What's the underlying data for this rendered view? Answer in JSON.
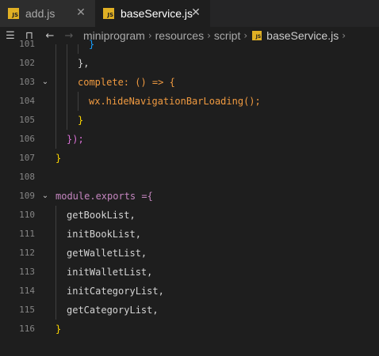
{
  "tabs": [
    {
      "label": "add.js",
      "badge": "JS",
      "active": false
    },
    {
      "label": "baseService.js",
      "badge": "JS",
      "active": true
    }
  ],
  "breadcrumb": {
    "items": [
      "miniprogram",
      "resources",
      "script"
    ],
    "file_badge": "JS",
    "file": "baseService.js"
  },
  "editor": {
    "lines": [
      {
        "num": "101",
        "text": "}"
      },
      {
        "num": "102",
        "text": "},"
      },
      {
        "num": "103",
        "text": "complete: () => {"
      },
      {
        "num": "104",
        "text": "wx.hideNavigationBarLoading();"
      },
      {
        "num": "105",
        "text": "}"
      },
      {
        "num": "106",
        "text": "});"
      },
      {
        "num": "107",
        "text": "}"
      },
      {
        "num": "108",
        "text": ""
      },
      {
        "num": "109",
        "text": "module.exports ={"
      },
      {
        "num": "110",
        "text": "getBookList,"
      },
      {
        "num": "111",
        "text": "initBookList,"
      },
      {
        "num": "112",
        "text": "getWalletList,"
      },
      {
        "num": "113",
        "text": "initWalletList,"
      },
      {
        "num": "114",
        "text": "initCategoryList,"
      },
      {
        "num": "115",
        "text": "getCategoryList,"
      },
      {
        "num": "116",
        "text": "}"
      }
    ]
  },
  "colors": {
    "background": "#1e1e1e",
    "tabbar": "#252526",
    "js_badge": "#e0b024",
    "function": "#f09a40",
    "keyword": "#c586c0"
  }
}
